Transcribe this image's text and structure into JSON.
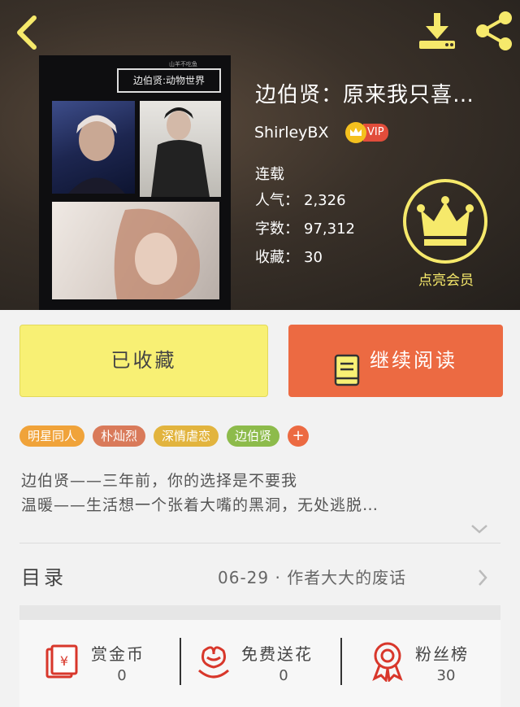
{
  "header": {
    "cover_text": {
      "title": "边伯贤:动物世界",
      "subtitle": "山羊不吃鱼"
    },
    "title": "边伯贤：原来我只喜…",
    "author": "ShirleyBX",
    "vip_label": "VIP",
    "status": "连载",
    "stats": [
      {
        "label": "人气：",
        "value": "2,326"
      },
      {
        "label": "字数：",
        "value": "97,312"
      },
      {
        "label": "收藏：",
        "value": "30"
      }
    ],
    "member_label": "点亮会员",
    "colors": {
      "accent_yellow": "#f6e96b",
      "vip_red": "#e24d3b"
    }
  },
  "actions": {
    "collected_label": "已收藏",
    "read_label": "继续阅读"
  },
  "tags": [
    {
      "label": "明星同人",
      "color": "#f0a33a"
    },
    {
      "label": "朴灿烈",
      "color": "#d97a5a"
    },
    {
      "label": "深情虐恋",
      "color": "#e2b43e"
    },
    {
      "label": "边伯贤",
      "color": "#8dbb4b"
    },
    {
      "label": "+",
      "color": "#ec6a42"
    }
  ],
  "synopsis": {
    "line1": "边伯贤——三年前，你的选择是不要我",
    "line2": "温暖——生活想一个张着大嘴的黑洞，无处逃脱…"
  },
  "toc": {
    "label": "目录",
    "latest": "06-29 · 作者大大的废话"
  },
  "bottom": [
    {
      "label": "赏金币",
      "value": "0",
      "icon": "red-envelope-icon"
    },
    {
      "label": "免费送花",
      "value": "0",
      "icon": "flower-icon"
    },
    {
      "label": "粉丝榜",
      "value": "30",
      "icon": "medal-icon"
    }
  ]
}
